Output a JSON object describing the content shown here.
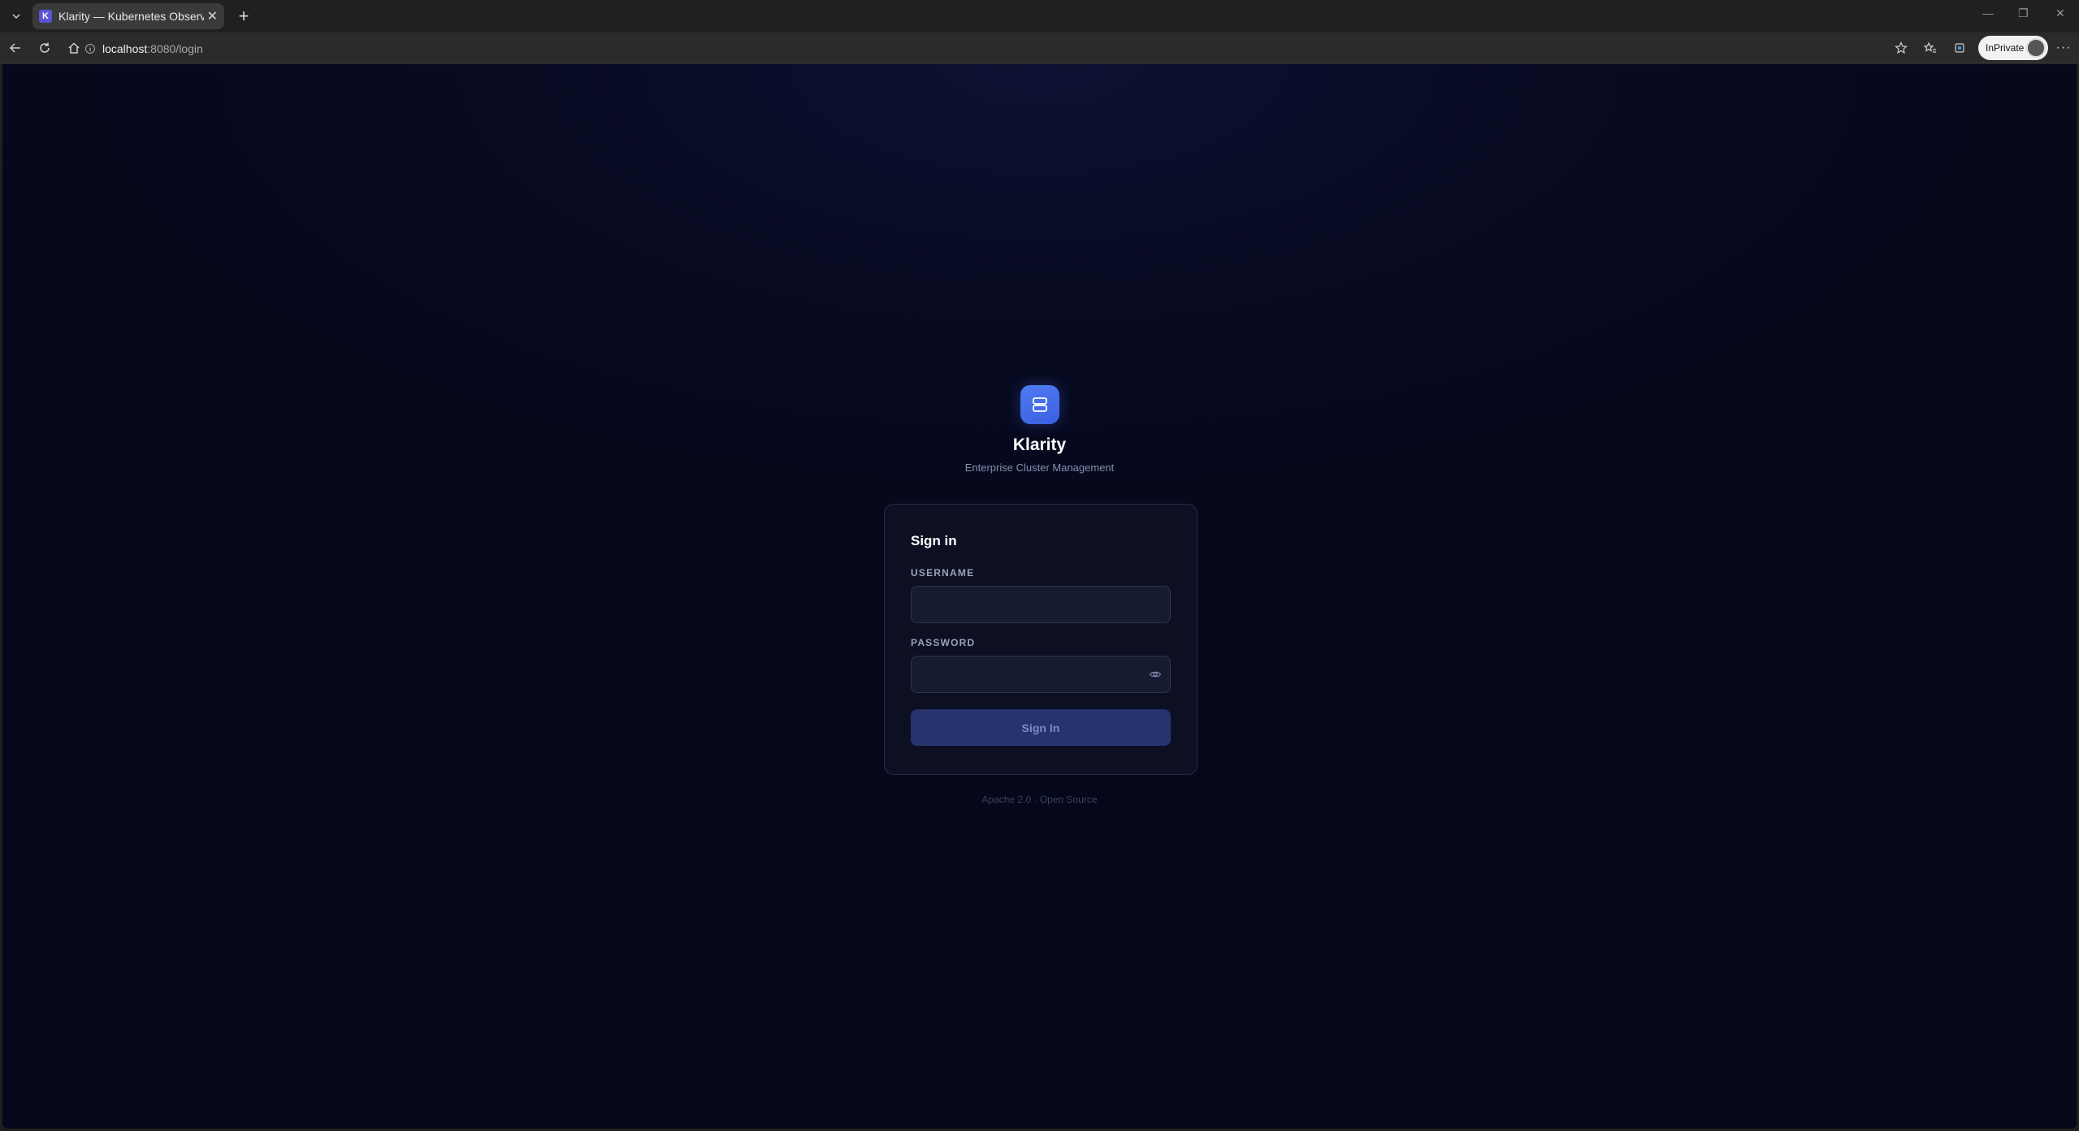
{
  "browser": {
    "tab_title": "Klarity — Kubernetes Observability",
    "tab_favicon_letter": "K",
    "url_host": "localhost",
    "url_rest": ":8080/login",
    "inprivate_label": "InPrivate"
  },
  "brand": {
    "name": "Klarity",
    "subtitle": "Enterprise Cluster Management",
    "icon": "server-stack-icon",
    "accent_color": "#4a72ee"
  },
  "login": {
    "title": "Sign in",
    "username_label": "USERNAME",
    "username_value": "",
    "password_label": "PASSWORD",
    "password_value": "",
    "submit_label": "Sign In"
  },
  "footer": {
    "text": "Apache 2.0 · Open Source"
  }
}
